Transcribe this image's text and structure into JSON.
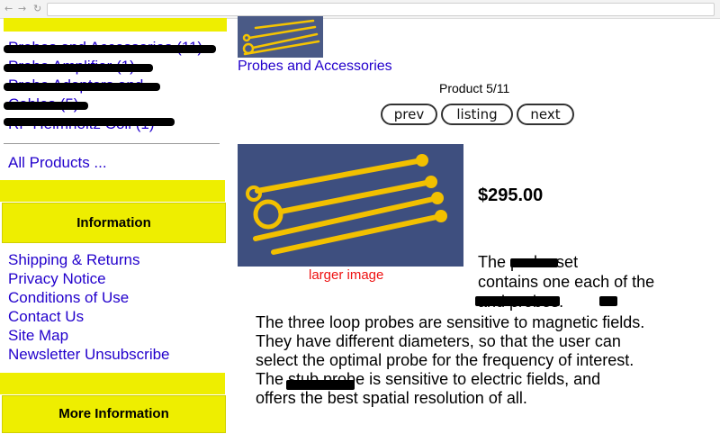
{
  "sidebar": {
    "categories": [
      {
        "name": "Probes and Accessories",
        "count": "(11)"
      },
      {
        "name": "Probe Amplifier",
        "count": "(1)"
      },
      {
        "name": "Probe Adapters and",
        "count": ""
      },
      {
        "name": "Cables",
        "count": "(5)"
      },
      {
        "name": "RF Helmholtz Coil",
        "count": "(1)"
      }
    ],
    "all_products": "All Products ...",
    "information_heading": "Information",
    "info_links": [
      "Shipping & Returns",
      "Privacy Notice",
      "Conditions of Use",
      "Contact Us",
      "Site Map",
      "Newsletter Unsubscribe"
    ],
    "more_info_heading": "More Information"
  },
  "product": {
    "category_link": "Probes and Accessories",
    "counter": "Product 5/11",
    "nav": {
      "prev": "prev",
      "listing": "listing",
      "next": "next"
    },
    "larger_image": "larger image",
    "price": "$295.00",
    "description_lines": [
      "The          probe set",
      "contains one each of the",
      "                    and      probes.",
      "The three loop probes are sensitive to magnetic fields.",
      "They have different diameters, so that the user can",
      "select the optimal probe for the frequency of interest.",
      "The             stub probe is sensitive to electric fields, and",
      "offers the best spatial resolution of all."
    ]
  },
  "colors": {
    "accent_yellow": "#eeee00",
    "link_blue": "#2200cc",
    "image_red": "#ee1111"
  }
}
